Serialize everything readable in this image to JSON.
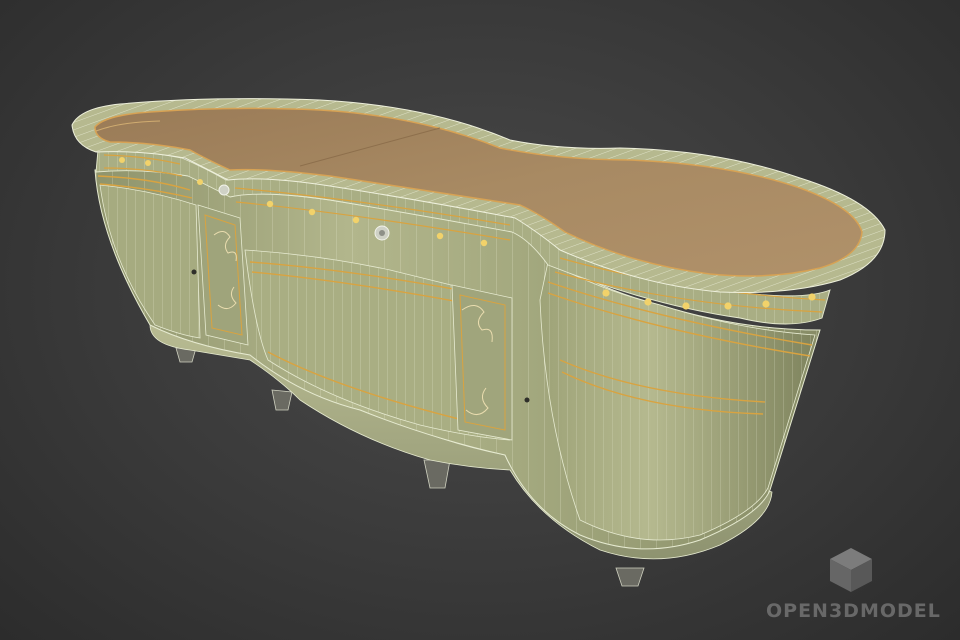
{
  "watermark": {
    "text": "OPEN3DMODEL",
    "icon": "cube-icon",
    "color": "#6f6f6f"
  },
  "colors": {
    "body": "#a7ac82",
    "top": "#a48560",
    "wire": "#e6ead0",
    "inlay": "#d9a340",
    "background": "#3a3a3a"
  }
}
